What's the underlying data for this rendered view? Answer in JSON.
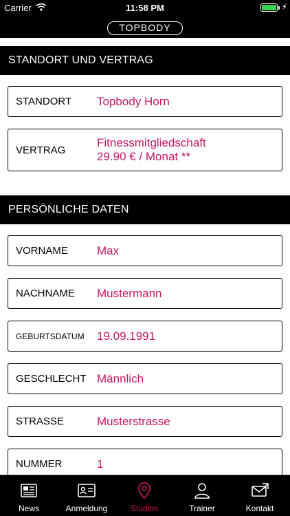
{
  "status_bar": {
    "carrier": "Carrier",
    "time": "11:58 PM",
    "wifi_icon": "wifi-icon",
    "battery_icon": "battery-icon"
  },
  "nav": {
    "logo_text": "TOPBODY"
  },
  "sections": {
    "standort": {
      "title": "STANDORT UND VERTRAG",
      "fields": [
        {
          "label": "STANDORT",
          "value": "Topbody Horn"
        },
        {
          "label": "VERTRAG",
          "value_line1": "Fitnessmitgliedschaft",
          "value_line2": "29.90 € / Monat **"
        }
      ]
    },
    "persoenlich": {
      "title": "PERSÖNLICHE DATEN",
      "fields": [
        {
          "label": "VORNAME",
          "value": "Max"
        },
        {
          "label": "NACHNAME",
          "value": "Mustermann"
        },
        {
          "label": "GEBURTSDATUM",
          "value": "19.09.1991"
        },
        {
          "label": "GESCHLECHT",
          "value": "Männlich"
        },
        {
          "label": "STRASSE",
          "value": "Musterstrasse"
        },
        {
          "label": "NUMMER",
          "value": "1"
        }
      ]
    }
  },
  "tabs": [
    {
      "label": "News",
      "icon": "newspaper-icon",
      "active": false
    },
    {
      "label": "Anmeldung",
      "icon": "id-card-icon",
      "active": false
    },
    {
      "label": "Studios",
      "icon": "map-pin-icon",
      "active": true
    },
    {
      "label": "Trainer",
      "icon": "person-icon",
      "active": false
    },
    {
      "label": "Kontakt",
      "icon": "mail-icon",
      "active": false
    }
  ],
  "colors": {
    "accent": "#c2185b",
    "bar_background": "#000000",
    "battery": "#39d353"
  }
}
